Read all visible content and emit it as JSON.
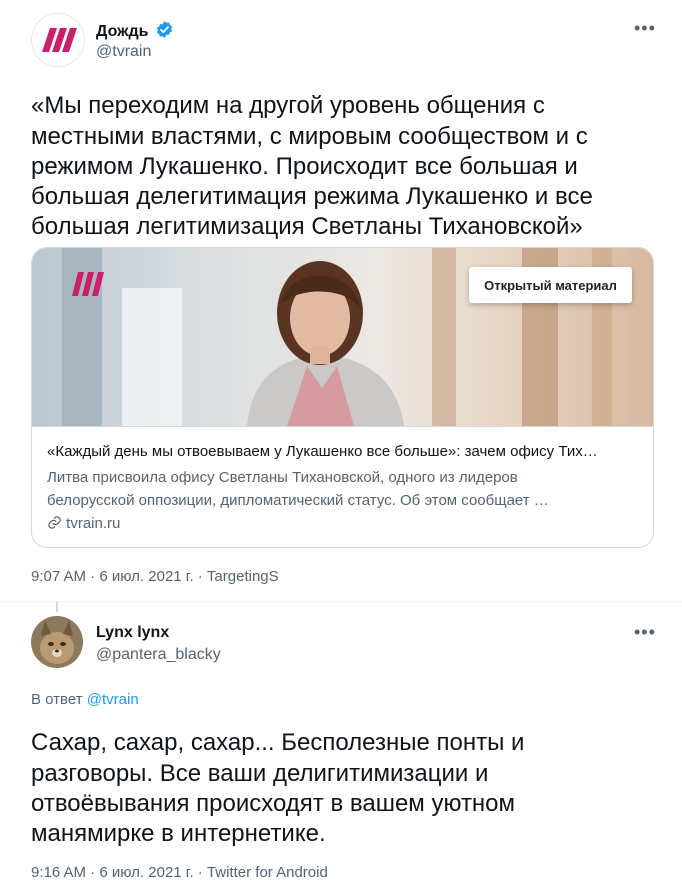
{
  "tweet1": {
    "display_name": "Дождь",
    "handle": "@tvrain",
    "text_lines": [
      "«Мы переходим на другой уровень общения с",
      "местными властями, с мировым сообществом и с",
      "режимом Лукашенко. Происходит все большая и",
      "большая делегитимация режима Лукашенко и все",
      "большая легитимизация Светланы Тихановской»"
    ],
    "card": {
      "badge": "Открытый материал",
      "title": "«Каждый день мы отвоевываем у Лукашенко все больше»: зачем офису Тих…",
      "desc_lines": [
        "Литва присвоила офису Светланы Тихановской, одного из лидеров",
        "белорусской оппозиции, дипломатический статус. Об этом сообщает …"
      ],
      "domain": "tvrain.ru"
    },
    "meta": "9:07 AM · 6 июл. 2021 г. · TargetingS"
  },
  "tweet2": {
    "display_name": "Lynx lynx",
    "handle": "@pantera_blacky",
    "reply_prefix": "В ответ",
    "reply_to": "@tvrain",
    "text_lines": [
      "Сахар, сахар, сахар... Бесполезные понты и",
      "разговоры. Все ваши делигитимизации и",
      "отвоёвывания происходят в вашем уютном",
      "манямирке в интернетике."
    ],
    "meta": "9:16 AM · 6 июл. 2021 г. · Twitter for Android"
  },
  "icons": {
    "verified": "verified-badge-icon",
    "more": "more-dots-icon",
    "link": "link-icon"
  },
  "colors": {
    "brand_dozhd": "#cc1f6b",
    "twitter_blue": "#1d9bf0",
    "secondary_text": "#536471"
  }
}
